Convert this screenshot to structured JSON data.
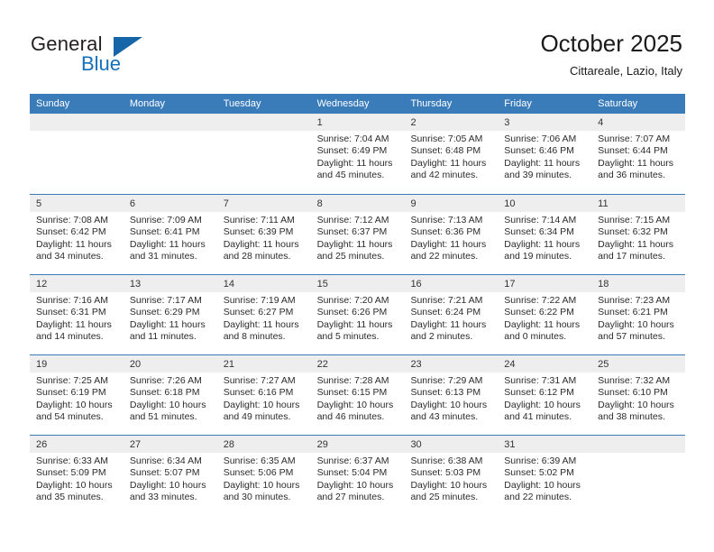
{
  "brand": {
    "name_top": "General",
    "name_bottom": "Blue",
    "triangle_color": "#1565a8",
    "blue_color": "#1570bb"
  },
  "header": {
    "title": "October 2025",
    "subtitle": "Cittareale, Lazio, Italy"
  },
  "theme": {
    "header_blue": "#3a7cba",
    "day_band_gray": "#eeeeee",
    "text": "#1a1a1a"
  },
  "weekdays": [
    "Sunday",
    "Monday",
    "Tuesday",
    "Wednesday",
    "Thursday",
    "Friday",
    "Saturday"
  ],
  "weeks": [
    [
      {
        "day": "",
        "sunrise": "",
        "sunset": "",
        "daylight_line1": "",
        "daylight_line2": ""
      },
      {
        "day": "",
        "sunrise": "",
        "sunset": "",
        "daylight_line1": "",
        "daylight_line2": ""
      },
      {
        "day": "",
        "sunrise": "",
        "sunset": "",
        "daylight_line1": "",
        "daylight_line2": ""
      },
      {
        "day": "1",
        "sunrise": "Sunrise: 7:04 AM",
        "sunset": "Sunset: 6:49 PM",
        "daylight_line1": "Daylight: 11 hours",
        "daylight_line2": "and 45 minutes."
      },
      {
        "day": "2",
        "sunrise": "Sunrise: 7:05 AM",
        "sunset": "Sunset: 6:48 PM",
        "daylight_line1": "Daylight: 11 hours",
        "daylight_line2": "and 42 minutes."
      },
      {
        "day": "3",
        "sunrise": "Sunrise: 7:06 AM",
        "sunset": "Sunset: 6:46 PM",
        "daylight_line1": "Daylight: 11 hours",
        "daylight_line2": "and 39 minutes."
      },
      {
        "day": "4",
        "sunrise": "Sunrise: 7:07 AM",
        "sunset": "Sunset: 6:44 PM",
        "daylight_line1": "Daylight: 11 hours",
        "daylight_line2": "and 36 minutes."
      }
    ],
    [
      {
        "day": "5",
        "sunrise": "Sunrise: 7:08 AM",
        "sunset": "Sunset: 6:42 PM",
        "daylight_line1": "Daylight: 11 hours",
        "daylight_line2": "and 34 minutes."
      },
      {
        "day": "6",
        "sunrise": "Sunrise: 7:09 AM",
        "sunset": "Sunset: 6:41 PM",
        "daylight_line1": "Daylight: 11 hours",
        "daylight_line2": "and 31 minutes."
      },
      {
        "day": "7",
        "sunrise": "Sunrise: 7:11 AM",
        "sunset": "Sunset: 6:39 PM",
        "daylight_line1": "Daylight: 11 hours",
        "daylight_line2": "and 28 minutes."
      },
      {
        "day": "8",
        "sunrise": "Sunrise: 7:12 AM",
        "sunset": "Sunset: 6:37 PM",
        "daylight_line1": "Daylight: 11 hours",
        "daylight_line2": "and 25 minutes."
      },
      {
        "day": "9",
        "sunrise": "Sunrise: 7:13 AM",
        "sunset": "Sunset: 6:36 PM",
        "daylight_line1": "Daylight: 11 hours",
        "daylight_line2": "and 22 minutes."
      },
      {
        "day": "10",
        "sunrise": "Sunrise: 7:14 AM",
        "sunset": "Sunset: 6:34 PM",
        "daylight_line1": "Daylight: 11 hours",
        "daylight_line2": "and 19 minutes."
      },
      {
        "day": "11",
        "sunrise": "Sunrise: 7:15 AM",
        "sunset": "Sunset: 6:32 PM",
        "daylight_line1": "Daylight: 11 hours",
        "daylight_line2": "and 17 minutes."
      }
    ],
    [
      {
        "day": "12",
        "sunrise": "Sunrise: 7:16 AM",
        "sunset": "Sunset: 6:31 PM",
        "daylight_line1": "Daylight: 11 hours",
        "daylight_line2": "and 14 minutes."
      },
      {
        "day": "13",
        "sunrise": "Sunrise: 7:17 AM",
        "sunset": "Sunset: 6:29 PM",
        "daylight_line1": "Daylight: 11 hours",
        "daylight_line2": "and 11 minutes."
      },
      {
        "day": "14",
        "sunrise": "Sunrise: 7:19 AM",
        "sunset": "Sunset: 6:27 PM",
        "daylight_line1": "Daylight: 11 hours",
        "daylight_line2": "and 8 minutes."
      },
      {
        "day": "15",
        "sunrise": "Sunrise: 7:20 AM",
        "sunset": "Sunset: 6:26 PM",
        "daylight_line1": "Daylight: 11 hours",
        "daylight_line2": "and 5 minutes."
      },
      {
        "day": "16",
        "sunrise": "Sunrise: 7:21 AM",
        "sunset": "Sunset: 6:24 PM",
        "daylight_line1": "Daylight: 11 hours",
        "daylight_line2": "and 2 minutes."
      },
      {
        "day": "17",
        "sunrise": "Sunrise: 7:22 AM",
        "sunset": "Sunset: 6:22 PM",
        "daylight_line1": "Daylight: 11 hours",
        "daylight_line2": "and 0 minutes."
      },
      {
        "day": "18",
        "sunrise": "Sunrise: 7:23 AM",
        "sunset": "Sunset: 6:21 PM",
        "daylight_line1": "Daylight: 10 hours",
        "daylight_line2": "and 57 minutes."
      }
    ],
    [
      {
        "day": "19",
        "sunrise": "Sunrise: 7:25 AM",
        "sunset": "Sunset: 6:19 PM",
        "daylight_line1": "Daylight: 10 hours",
        "daylight_line2": "and 54 minutes."
      },
      {
        "day": "20",
        "sunrise": "Sunrise: 7:26 AM",
        "sunset": "Sunset: 6:18 PM",
        "daylight_line1": "Daylight: 10 hours",
        "daylight_line2": "and 51 minutes."
      },
      {
        "day": "21",
        "sunrise": "Sunrise: 7:27 AM",
        "sunset": "Sunset: 6:16 PM",
        "daylight_line1": "Daylight: 10 hours",
        "daylight_line2": "and 49 minutes."
      },
      {
        "day": "22",
        "sunrise": "Sunrise: 7:28 AM",
        "sunset": "Sunset: 6:15 PM",
        "daylight_line1": "Daylight: 10 hours",
        "daylight_line2": "and 46 minutes."
      },
      {
        "day": "23",
        "sunrise": "Sunrise: 7:29 AM",
        "sunset": "Sunset: 6:13 PM",
        "daylight_line1": "Daylight: 10 hours",
        "daylight_line2": "and 43 minutes."
      },
      {
        "day": "24",
        "sunrise": "Sunrise: 7:31 AM",
        "sunset": "Sunset: 6:12 PM",
        "daylight_line1": "Daylight: 10 hours",
        "daylight_line2": "and 41 minutes."
      },
      {
        "day": "25",
        "sunrise": "Sunrise: 7:32 AM",
        "sunset": "Sunset: 6:10 PM",
        "daylight_line1": "Daylight: 10 hours",
        "daylight_line2": "and 38 minutes."
      }
    ],
    [
      {
        "day": "26",
        "sunrise": "Sunrise: 6:33 AM",
        "sunset": "Sunset: 5:09 PM",
        "daylight_line1": "Daylight: 10 hours",
        "daylight_line2": "and 35 minutes."
      },
      {
        "day": "27",
        "sunrise": "Sunrise: 6:34 AM",
        "sunset": "Sunset: 5:07 PM",
        "daylight_line1": "Daylight: 10 hours",
        "daylight_line2": "and 33 minutes."
      },
      {
        "day": "28",
        "sunrise": "Sunrise: 6:35 AM",
        "sunset": "Sunset: 5:06 PM",
        "daylight_line1": "Daylight: 10 hours",
        "daylight_line2": "and 30 minutes."
      },
      {
        "day": "29",
        "sunrise": "Sunrise: 6:37 AM",
        "sunset": "Sunset: 5:04 PM",
        "daylight_line1": "Daylight: 10 hours",
        "daylight_line2": "and 27 minutes."
      },
      {
        "day": "30",
        "sunrise": "Sunrise: 6:38 AM",
        "sunset": "Sunset: 5:03 PM",
        "daylight_line1": "Daylight: 10 hours",
        "daylight_line2": "and 25 minutes."
      },
      {
        "day": "31",
        "sunrise": "Sunrise: 6:39 AM",
        "sunset": "Sunset: 5:02 PM",
        "daylight_line1": "Daylight: 10 hours",
        "daylight_line2": "and 22 minutes."
      },
      {
        "day": "",
        "sunrise": "",
        "sunset": "",
        "daylight_line1": "",
        "daylight_line2": ""
      }
    ]
  ]
}
